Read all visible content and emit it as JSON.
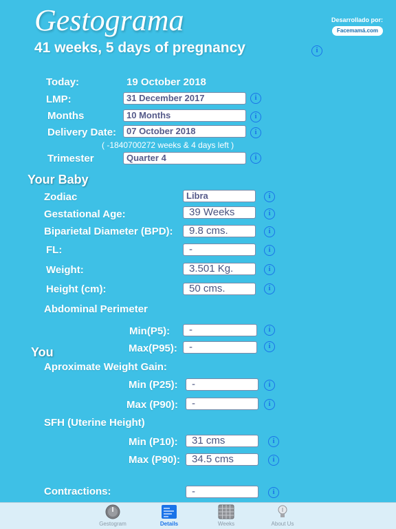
{
  "header": {
    "title": "Gestograma",
    "subtitle": "41 weeks, 5 days of pregnancy",
    "developed_by": "Desarrollado por:",
    "logo_text": "Facemamá.com"
  },
  "summary": {
    "today_label": "Today:",
    "today_value": "19 October 2018",
    "lmp_label": "LMP:",
    "lmp_value": "31 December 2017",
    "months_label": "Months",
    "months_value": "10 Months",
    "delivery_label": "Delivery Date:",
    "delivery_value": "07 October 2018",
    "delivery_note": "( -1840700272 weeks & 4 days left )",
    "trimester_label": "Trimester",
    "trimester_value": "Quarter 4"
  },
  "baby": {
    "section_title": "Your Baby",
    "zodiac_label": "Zodiac",
    "zodiac_value": "Libra",
    "gest_age_label": "Gestational Age:",
    "gest_age_value": "39 Weeks",
    "bpd_label": "Biparietal Diameter (BPD):",
    "bpd_value": "9.8 cms.",
    "fl_label": "FL:",
    "fl_value": "-",
    "weight_label": "Weight:",
    "weight_value": "3.501 Kg.",
    "height_label": "Height (cm):",
    "height_value": "50 cms.",
    "abdominal_label": "Abdominal Perimeter",
    "ap_min_label": "Min(P5):",
    "ap_min_value": "-",
    "ap_max_label": "Max(P95):",
    "ap_max_value": "-"
  },
  "you": {
    "section_title": "You",
    "weight_gain_label": "Aproximate Weight Gain:",
    "wg_min_label": "Min (P25):",
    "wg_min_value": "-",
    "wg_max_label": "Max (P90):",
    "wg_max_value": "-",
    "sfh_label": "SFH (Uterine Height)",
    "sfh_min_label": "Min (P10):",
    "sfh_min_value": "31 cms",
    "sfh_max_label": "Max (P90):",
    "sfh_max_value": "34.5 cms",
    "contractions_label": "Contractions:",
    "contractions_value": "-"
  },
  "info_glyph": "i",
  "tabs": [
    {
      "label": "Gestogram",
      "icon": "gauge-icon"
    },
    {
      "label": "Details",
      "icon": "details-icon"
    },
    {
      "label": "Weeks",
      "icon": "calendar-icon"
    },
    {
      "label": "About Us",
      "icon": "lightbulb-icon"
    }
  ],
  "colors": {
    "background": "#3ec0e6",
    "accent": "#1a73e8",
    "tabbar": "#dbeef8"
  }
}
